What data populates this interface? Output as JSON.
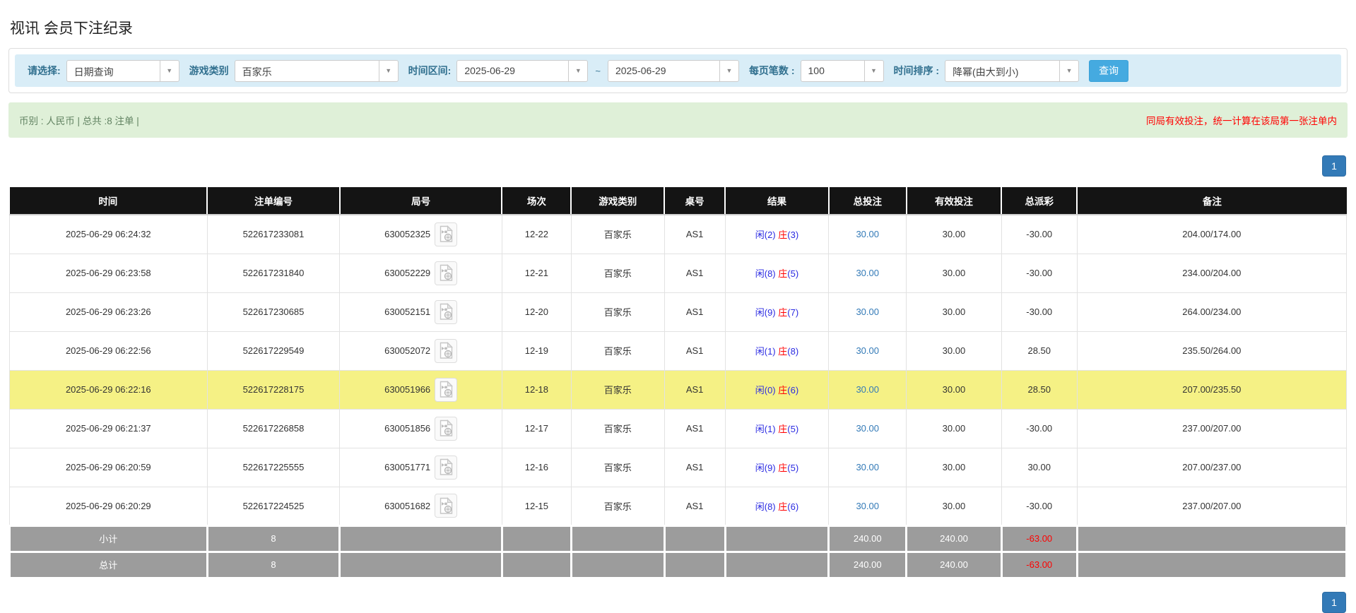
{
  "page": {
    "title": "视讯 会员下注纪录"
  },
  "colors": {
    "accent_blue": "#337ab7",
    "filter_bar_bg": "#d9edf7",
    "summary_bg": "#dff0d8",
    "header_bg": "#141414",
    "footer_bg": "#9c9c9c",
    "highlight_row": "#f5f185",
    "negative_red": "#ff0000",
    "result_blue": "#2b2be2",
    "search_btn_bg": "#45aae0"
  },
  "filters": {
    "select_type": {
      "label": "请选择:",
      "value": "日期查询"
    },
    "game_category": {
      "label": "游戏类别",
      "value": "百家乐"
    },
    "time_range": {
      "label": "时间区间:",
      "from": "2025-06-29",
      "tilde": "~",
      "to": "2025-06-29"
    },
    "per_page": {
      "label": "每页笔数 :",
      "value": "100"
    },
    "time_sort": {
      "label": "时间排序 :",
      "value": "降幂(由大到小)"
    },
    "search_button": "查询",
    "dropdown_arrow_icon": "▼"
  },
  "summary": {
    "left": "币别 : 人民币 | 总共 :8 注单 |",
    "right": "同局有效投注，统一计算在该局第一张注单内"
  },
  "pagination": {
    "page": "1"
  },
  "table": {
    "headers": [
      "时间",
      "注单编号",
      "局号",
      "场次",
      "游戏类别",
      "桌号",
      "结果",
      "总投注",
      "有效投注",
      "总派彩",
      "备注"
    ],
    "rows": [
      {
        "time": "2025-06-29 06:24:32",
        "bet_id": "522617233081",
        "round": "630052325",
        "session": "12-22",
        "game": "百家乐",
        "table": "AS1",
        "result_player": "闲(2)",
        "result_banker": "庄",
        "result_banker_score": "(3)",
        "total_bet": "30.00",
        "valid_bet": "30.00",
        "payout": "-30.00",
        "payout_negative": true,
        "remark": "204.00/174.00",
        "highlighted": false
      },
      {
        "time": "2025-06-29 06:23:58",
        "bet_id": "522617231840",
        "round": "630052229",
        "session": "12-21",
        "game": "百家乐",
        "table": "AS1",
        "result_player": "闲(8)",
        "result_banker": "庄",
        "result_banker_score": "(5)",
        "total_bet": "30.00",
        "valid_bet": "30.00",
        "payout": "-30.00",
        "payout_negative": true,
        "remark": "234.00/204.00",
        "highlighted": false
      },
      {
        "time": "2025-06-29 06:23:26",
        "bet_id": "522617230685",
        "round": "630052151",
        "session": "12-20",
        "game": "百家乐",
        "table": "AS1",
        "result_player": "闲(9)",
        "result_banker": "庄",
        "result_banker_score": "(7)",
        "total_bet": "30.00",
        "valid_bet": "30.00",
        "payout": "-30.00",
        "payout_negative": true,
        "remark": "264.00/234.00",
        "highlighted": false
      },
      {
        "time": "2025-06-29 06:22:56",
        "bet_id": "522617229549",
        "round": "630052072",
        "session": "12-19",
        "game": "百家乐",
        "table": "AS1",
        "result_player": "闲(1)",
        "result_banker": "庄",
        "result_banker_score": "(8)",
        "total_bet": "30.00",
        "valid_bet": "30.00",
        "payout": "28.50",
        "payout_negative": false,
        "remark": "235.50/264.00",
        "highlighted": false
      },
      {
        "time": "2025-06-29 06:22:16",
        "bet_id": "522617228175",
        "round": "630051966",
        "session": "12-18",
        "game": "百家乐",
        "table": "AS1",
        "result_player": "闲(0)",
        "result_banker": "庄",
        "result_banker_score": "(6)",
        "total_bet": "30.00",
        "valid_bet": "30.00",
        "payout": "28.50",
        "payout_negative": false,
        "remark": "207.00/235.50",
        "highlighted": true
      },
      {
        "time": "2025-06-29 06:21:37",
        "bet_id": "522617226858",
        "round": "630051856",
        "session": "12-17",
        "game": "百家乐",
        "table": "AS1",
        "result_player": "闲(1)",
        "result_banker": "庄",
        "result_banker_score": "(5)",
        "total_bet": "30.00",
        "valid_bet": "30.00",
        "payout": "-30.00",
        "payout_negative": true,
        "remark": "237.00/207.00",
        "highlighted": false
      },
      {
        "time": "2025-06-29 06:20:59",
        "bet_id": "522617225555",
        "round": "630051771",
        "session": "12-16",
        "game": "百家乐",
        "table": "AS1",
        "result_player": "闲(9)",
        "result_banker": "庄",
        "result_banker_score": "(5)",
        "total_bet": "30.00",
        "valid_bet": "30.00",
        "payout": "30.00",
        "payout_negative": false,
        "remark": "207.00/237.00",
        "highlighted": false
      },
      {
        "time": "2025-06-29 06:20:29",
        "bet_id": "522617224525",
        "round": "630051682",
        "session": "12-15",
        "game": "百家乐",
        "table": "AS1",
        "result_player": "闲(8)",
        "result_banker": "庄",
        "result_banker_score": "(6)",
        "total_bet": "30.00",
        "valid_bet": "30.00",
        "payout": "-30.00",
        "payout_negative": true,
        "remark": "237.00/207.00",
        "highlighted": false
      }
    ],
    "footer": [
      {
        "label": "小计",
        "count": "8",
        "total_bet": "240.00",
        "valid_bet": "240.00",
        "payout": "-63.00",
        "payout_negative": true
      },
      {
        "label": "总计",
        "count": "8",
        "total_bet": "240.00",
        "valid_bet": "240.00",
        "payout": "-63.00",
        "payout_negative": true
      }
    ],
    "video_icon": "video-replay-icon"
  }
}
